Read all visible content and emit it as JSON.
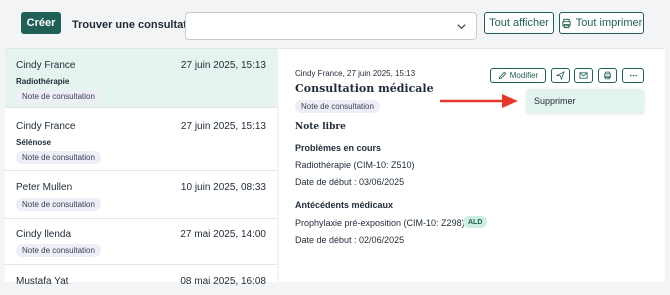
{
  "toolbar": {
    "create_label": "Créer",
    "search_label": "Trouver une consultation",
    "select_value": "",
    "show_all_label": "Tout afficher",
    "print_all_label": "Tout imprimer"
  },
  "consultations": [
    {
      "name": "Cindy France",
      "date": "27 juin 2025, 15:13",
      "subtitle": "Radiothérapie",
      "tag": "Note de consultation"
    },
    {
      "name": "Cindy France",
      "date": "27 juin 2025, 15:13",
      "subtitle": "Sélénose",
      "tag": "Note de consultation"
    },
    {
      "name": "Peter Mullen",
      "date": "10 juin 2025, 08:33",
      "subtitle": "",
      "tag": "Note de consultation"
    },
    {
      "name": "Cindy llenda",
      "date": "27 mai 2025, 14:00",
      "subtitle": "",
      "tag": "Note de consultation"
    },
    {
      "name": "Mustafa Yat",
      "date": "08 mai 2025, 16:08",
      "subtitle": "",
      "tag": ""
    }
  ],
  "detail": {
    "meta": "Cindy France, 27 juin 2025, 15:13",
    "title": "Consultation médicale",
    "tag": "Note de consultation",
    "actions": {
      "modify_label": "Modifier"
    },
    "menu": {
      "delete_label": "Supprimer"
    },
    "free_note": "Note libre",
    "problems_heading": "Problèmes en cours",
    "problem_1": "Radiothérapie (CIM-10: Z510)",
    "problem_1_start": "Date de début : 03/06/2025",
    "history_heading": "Antécédents médicaux",
    "history_1": "Prophylaxie pré-exposition (CIM-10: Z298)",
    "history_1_badge": "ALD",
    "history_1_start": "Date de début : 02/06/2025"
  },
  "colors": {
    "primary": "#1f5f56",
    "selected_row": "#e6f4ef",
    "tag_bg": "#eeeef6",
    "annotation_arrow": "#e53a2b"
  }
}
